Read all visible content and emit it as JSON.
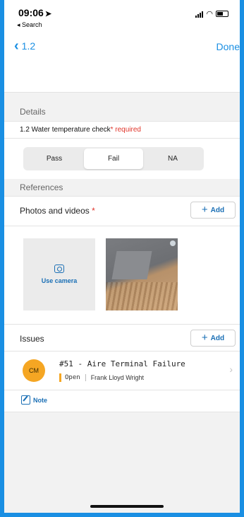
{
  "status_bar": {
    "time": "09:06",
    "back_app": "◂ Search"
  },
  "nav": {
    "back_label": "1.2",
    "done_label": "Done"
  },
  "details": {
    "section_label": "Details",
    "question": "1.2 Water temperature check",
    "required_label": "* required",
    "options": [
      "Pass",
      "Fail",
      "NA"
    ],
    "selected": "Fail"
  },
  "references": {
    "section_label": "References",
    "photos_label": "Photos and videos",
    "photos_required": " *",
    "add_label": "Add",
    "use_camera_label": "Use camera"
  },
  "issues": {
    "label": "Issues",
    "add_label": "Add",
    "items": [
      {
        "initials": "CM",
        "title": "#51 - Aire Terminal Failure",
        "status": "Open",
        "assignee": "Frank Lloyd Wright",
        "status_color": "#f5a623"
      }
    ]
  },
  "note": {
    "label": "Note"
  },
  "colors": {
    "accent": "#1a8fe3",
    "link": "#1a6fb5",
    "required": "#e0342a",
    "avatar": "#f5a623"
  }
}
